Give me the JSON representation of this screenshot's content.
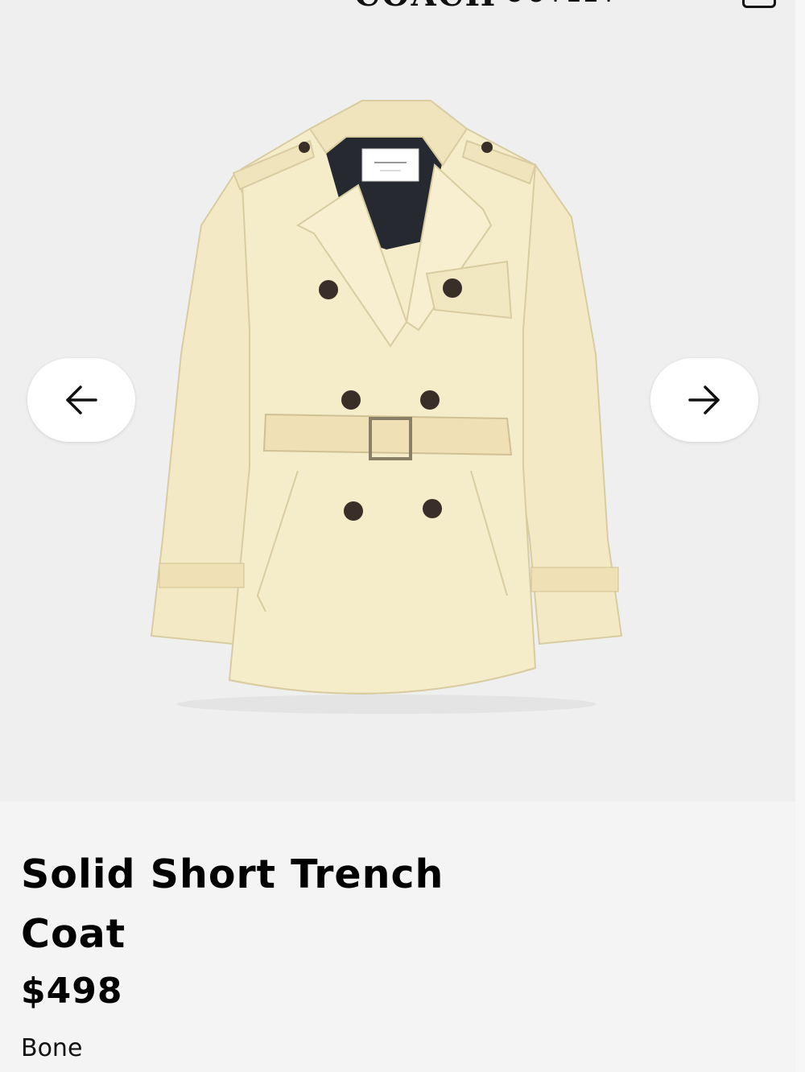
{
  "header": {
    "brand_name": "COACH",
    "brand_sub": "OUTLET",
    "bag_icon": "shopping-bag-icon"
  },
  "gallery": {
    "image_alt": "Solid Short Trench Coat in Bone",
    "prev_icon": "arrow-left-icon",
    "next_icon": "arrow-right-icon",
    "coat_color": "#f5ecc9",
    "button_color": "#3a2e28"
  },
  "product": {
    "title_line1": "Solid Short Trench",
    "title_line2": "Coat",
    "price": "$498",
    "color_name": "Bone"
  }
}
